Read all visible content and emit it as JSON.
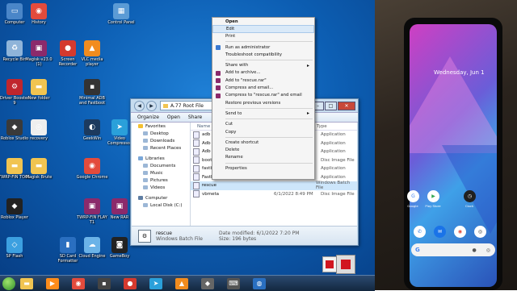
{
  "desktop": {
    "icons": [
      {
        "label": "Computer",
        "icon": "computer-icon",
        "color": "#4a86c8",
        "glyph": "▭"
      },
      {
        "label": "History",
        "icon": "chrome-icon",
        "color": "#e34b3c",
        "glyph": "◉"
      },
      {
        "label": "Control Panel",
        "icon": "control-panel-icon",
        "color": "#5b9bd5",
        "glyph": "▦"
      },
      {
        "label": "Recycle Bin",
        "icon": "recycle-bin-icon",
        "color": "#8fb4d9",
        "glyph": "♻"
      },
      {
        "label": "Magisk-v23.0 (1)",
        "icon": "winrar-icon",
        "color": "#8b2a6b",
        "glyph": "▣"
      },
      {
        "label": "Screen Recorder",
        "icon": "recorder-icon",
        "color": "#d43a2f",
        "glyph": "●"
      },
      {
        "label": "VLC media player",
        "icon": "vlc-icon",
        "color": "#f28c1e",
        "glyph": "▲"
      },
      {
        "label": "Driver Booster 9",
        "icon": "driver-booster-icon",
        "color": "#c0262d",
        "glyph": "⚙"
      },
      {
        "label": "New folder",
        "icon": "folder-icon",
        "color": "#f1c451",
        "glyph": "▬"
      },
      {
        "label": "Minimal ADB and Fastboot",
        "icon": "adb-icon",
        "color": "#333",
        "glyph": "▪"
      },
      {
        "label": "Roblox Studio",
        "icon": "roblox-studio-icon",
        "color": "#3a3a3a",
        "glyph": "◆"
      },
      {
        "label": "recovery",
        "icon": "image-file-icon",
        "color": "#eeeeee",
        "glyph": "◎"
      },
      {
        "label": "GeekWin",
        "icon": "geek-icon",
        "color": "#1c3a5e",
        "glyph": "◐"
      },
      {
        "label": "Video Compressor",
        "icon": "telegram-icon",
        "color": "#2aa0da",
        "glyph": "➤"
      },
      {
        "label": "TWRP-FIN TOOL",
        "icon": "folder-icon",
        "color": "#f1c451",
        "glyph": "▬"
      },
      {
        "label": "Magisk Brute",
        "icon": "folder-icon",
        "color": "#f1c451",
        "glyph": "▬"
      },
      {
        "label": "Google Chrome",
        "icon": "chrome-icon",
        "color": "#e34b3c",
        "glyph": "◉"
      },
      {
        "label": "Roblox Player",
        "icon": "roblox-icon",
        "color": "#222",
        "glyph": "◆"
      },
      {
        "label": "TWRP-FIN FLAY T1",
        "icon": "winrar-icon",
        "color": "#8b2a6b",
        "glyph": "▣"
      },
      {
        "label": "New RAR",
        "icon": "winrar-icon",
        "color": "#8b2a6b",
        "glyph": "▣"
      },
      {
        "label": "SP Flash",
        "icon": "sp-flash-icon",
        "color": "#3ca0e0",
        "glyph": "◇"
      },
      {
        "label": "SD Card Formatter",
        "icon": "sd-card-icon",
        "color": "#2a6fc0",
        "glyph": "▮"
      },
      {
        "label": "Cloud Engine",
        "icon": "cloud-icon",
        "color": "#6bb3e8",
        "glyph": "☁"
      },
      {
        "label": "GameBoy",
        "icon": "gameboy-icon",
        "color": "#222",
        "glyph": "◙"
      }
    ]
  },
  "taskbar": {
    "items": [
      {
        "icon": "explorer-icon",
        "glyph": "▬",
        "color": "#f1c451"
      },
      {
        "icon": "media-player-icon",
        "glyph": "▶",
        "color": "#ff8c1a"
      },
      {
        "icon": "chrome-icon",
        "glyph": "◉",
        "color": "#e34b3c"
      },
      {
        "icon": "terminal-icon",
        "glyph": "▪",
        "color": "#444"
      },
      {
        "icon": "recorder-icon",
        "glyph": "●",
        "color": "#d43a2f"
      },
      {
        "icon": "telegram-icon",
        "glyph": "➤",
        "color": "#2aa0da"
      },
      {
        "icon": "vlc-icon",
        "glyph": "▲",
        "color": "#f28c1e"
      },
      {
        "icon": "roblox-icon",
        "glyph": "◆",
        "color": "#666"
      },
      {
        "icon": "keyboard-icon",
        "glyph": "⌨",
        "color": "#555"
      },
      {
        "icon": "globe-icon",
        "glyph": "◍",
        "color": "#2a6fc0"
      }
    ]
  },
  "explorer": {
    "address": "A.77 Root File",
    "commands": {
      "organize": "Organize",
      "open": "Open",
      "share": "Share"
    },
    "nav": {
      "favorites_header": "Favorites",
      "favorites": [
        "Desktop",
        "Downloads",
        "Recent Places"
      ],
      "libraries_header": "Libraries",
      "libraries": [
        "Documents",
        "Music",
        "Pictures",
        "Videos"
      ],
      "computer_header": "Computer",
      "computer": [
        "Local Disk (C:)"
      ]
    },
    "columns": {
      "name": "Name",
      "date": "",
      "type": "Type"
    },
    "files": [
      {
        "name": "adb",
        "date": "",
        "type": "Application"
      },
      {
        "name": "Adb",
        "date": "",
        "type": "Application"
      },
      {
        "name": "Adb",
        "date": "",
        "type": "Application"
      },
      {
        "name": "boot",
        "date": "",
        "type": "Disc Image File"
      },
      {
        "name": "fastb",
        "date": "",
        "type": "Application"
      },
      {
        "name": "Fastb",
        "date": "",
        "type": "Application"
      },
      {
        "name": "rescue",
        "date": "",
        "type": "Windows Batch File"
      },
      {
        "name": "vbmeta",
        "date": "6/1/2022 8:49 PM",
        "type": "Disc Image File"
      }
    ],
    "selected_index": 6,
    "details": {
      "name": "rescue",
      "date_modified": "Date modified: 6/1/2022 7:20 PM",
      "kind": "Windows Batch File",
      "size": "Size: 196 bytes"
    }
  },
  "context_menu": {
    "items": [
      {
        "label": "Open",
        "bold": true,
        "icon": "",
        "color": ""
      },
      {
        "label": "Edit",
        "bold": false,
        "highlight": true,
        "icon": "",
        "color": ""
      },
      {
        "label": "Print",
        "bold": false,
        "icon": "",
        "color": ""
      },
      {
        "sep": true
      },
      {
        "label": "Run as administrator",
        "icon": "shield-icon",
        "color": "#3b7ad0"
      },
      {
        "label": "Troubleshoot compatibility",
        "icon": "",
        "color": ""
      },
      {
        "sep": true
      },
      {
        "label": "Share with",
        "arrow": true,
        "icon": "",
        "color": ""
      },
      {
        "label": "Add to archive...",
        "icon": "winrar-icon",
        "color": "#8b2a6b"
      },
      {
        "label": "Add to \"rescue.rar\"",
        "icon": "winrar-icon",
        "color": "#8b2a6b"
      },
      {
        "label": "Compress and email...",
        "icon": "winrar-icon",
        "color": "#8b2a6b"
      },
      {
        "label": "Compress to \"rescue.rar\" and email",
        "icon": "winrar-icon",
        "color": "#8b2a6b"
      },
      {
        "label": "Restore previous versions",
        "icon": "",
        "color": ""
      },
      {
        "sep": true
      },
      {
        "label": "Send to",
        "arrow": true,
        "icon": "",
        "color": ""
      },
      {
        "sep": true
      },
      {
        "label": "Cut",
        "icon": "",
        "color": ""
      },
      {
        "label": "Copy",
        "icon": "",
        "color": ""
      },
      {
        "sep": true
      },
      {
        "label": "Create shortcut",
        "icon": "",
        "color": ""
      },
      {
        "label": "Delete",
        "icon": "",
        "color": ""
      },
      {
        "label": "Rename",
        "icon": "",
        "color": ""
      },
      {
        "sep": true
      },
      {
        "label": "Properties",
        "icon": "",
        "color": ""
      }
    ]
  },
  "phone": {
    "date": "Wednesday, Jun 1",
    "apps": [
      {
        "name": "Google",
        "icon": "google-icon",
        "color": "#ffffff",
        "glyph": "G",
        "fg": "#4285f4"
      },
      {
        "name": "Play Store",
        "icon": "play-store-icon",
        "color": "#ffffff",
        "glyph": "▶",
        "fg": "#34a853"
      },
      {
        "name": "Clock",
        "icon": "clock-icon",
        "color": "#202020",
        "glyph": "◷",
        "fg": "#ffffff"
      },
      {
        "name": "Clock",
        "icon": "clock-icon",
        "color": "#202020",
        "glyph": "◷",
        "fg": "#ffffff"
      }
    ],
    "dock": [
      {
        "icon": "phone-icon",
        "color": "#ffffff",
        "glyph": "✆",
        "fg": "#2a7be4"
      },
      {
        "icon": "messages-icon",
        "color": "#1a73e8",
        "glyph": "✉",
        "fg": "#ffffff"
      },
      {
        "icon": "chrome-icon",
        "color": "#ffffff",
        "glyph": "◉",
        "fg": "#e34b3c"
      },
      {
        "icon": "camera-icon",
        "color": "#ffffff",
        "glyph": "◎",
        "fg": "#333333"
      }
    ]
  }
}
